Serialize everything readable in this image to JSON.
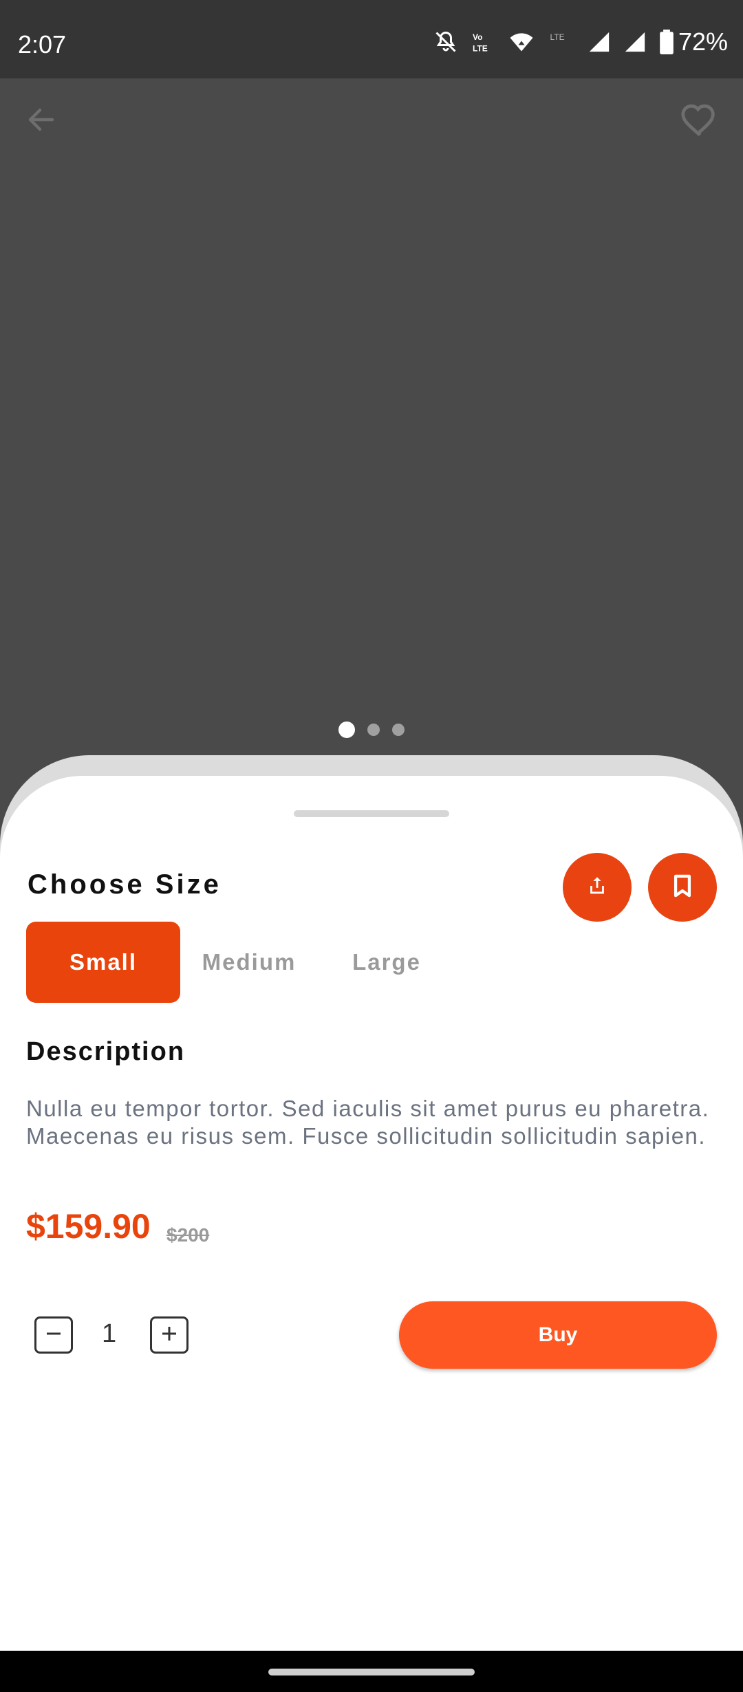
{
  "status_bar": {
    "time": "2:07",
    "battery": "72%",
    "icons": [
      "mute-icon",
      "volte-icon",
      "wifi-icon",
      "lte-icon",
      "signal-icon",
      "signal-icon",
      "battery-icon"
    ]
  },
  "hero": {
    "back_icon": "arrow-left-icon",
    "favorite_icon": "heart-outline-icon",
    "carousel": {
      "count": 3,
      "active_index": 0
    }
  },
  "product": {
    "choose_size_title": "Choose Size",
    "sizes": [
      "Small",
      "Medium",
      "Large"
    ],
    "selected_size": "Small",
    "description_title": "Description",
    "description": "Nulla eu tempor tortor. Sed iaculis sit amet purus eu pharetra. Maecenas eu risus sem. Fusce sollicitudin sollicitudin sapien.",
    "price": "$159.90",
    "old_price": "$200",
    "quantity": "1",
    "buy_label": "Buy"
  },
  "actions": {
    "share_icon": "share-icon",
    "bookmark_icon": "bookmark-icon"
  },
  "colors": {
    "accent": "#e8440c",
    "buy_button": "#ff5722",
    "hero_bg": "#4a4a4a",
    "status_bg": "#353535"
  }
}
